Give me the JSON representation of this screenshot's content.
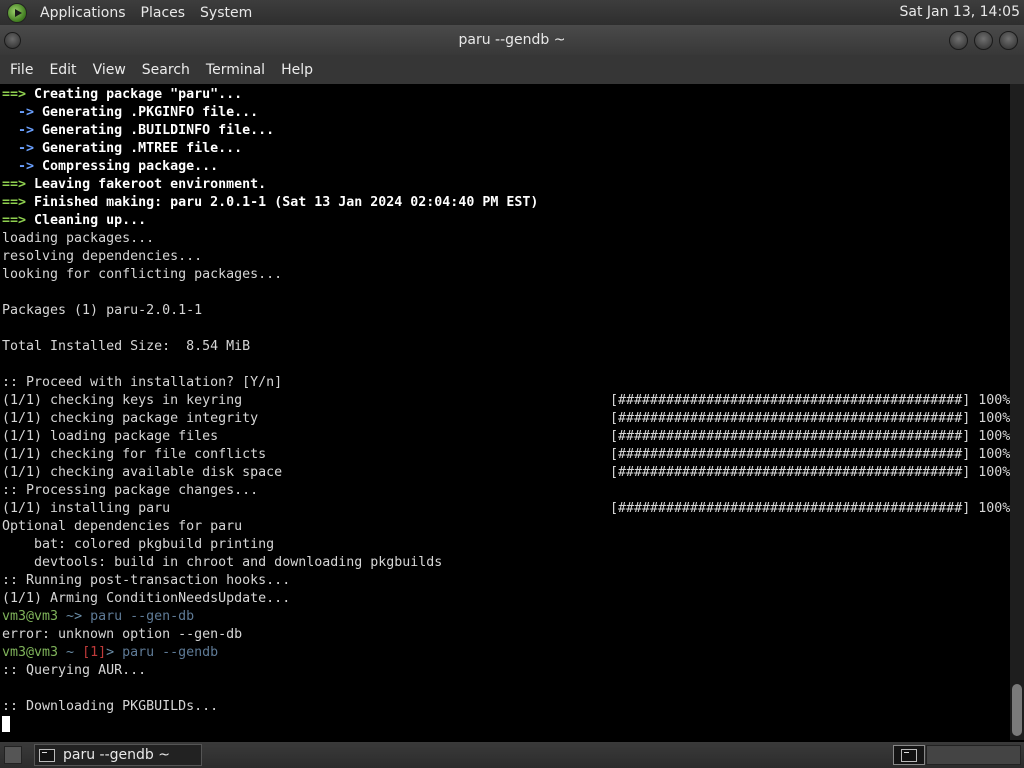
{
  "top_panel": {
    "menus": [
      "Applications",
      "Places",
      "System"
    ],
    "clock": "Sat Jan 13, 14:05",
    "logo_icon": "distro-logo-icon"
  },
  "window": {
    "title": "paru --gendb ~"
  },
  "menubar": [
    "File",
    "Edit",
    "View",
    "Search",
    "Terminal",
    "Help"
  ],
  "terminal": {
    "lines": [
      {
        "kind": "arrow-g",
        "prefix": "==> ",
        "text": "Creating package \"paru\"..."
      },
      {
        "kind": "arrow-b",
        "prefix": "  -> ",
        "text": "Generating .PKGINFO file..."
      },
      {
        "kind": "arrow-b",
        "prefix": "  -> ",
        "text": "Generating .BUILDINFO file..."
      },
      {
        "kind": "arrow-b",
        "prefix": "  -> ",
        "text": "Generating .MTREE file..."
      },
      {
        "kind": "arrow-b",
        "prefix": "  -> ",
        "text": "Compressing package..."
      },
      {
        "kind": "arrow-g",
        "prefix": "==> ",
        "text": "Leaving fakeroot environment."
      },
      {
        "kind": "arrow-g",
        "prefix": "==> ",
        "text": "Finished making: paru 2.0.1-1 (Sat 13 Jan 2024 02:04:40 PM EST)"
      },
      {
        "kind": "arrow-g",
        "prefix": "==> ",
        "text": "Cleaning up..."
      },
      {
        "kind": "plain",
        "text": "loading packages..."
      },
      {
        "kind": "plain",
        "text": "resolving dependencies..."
      },
      {
        "kind": "plain",
        "text": "looking for conflicting packages..."
      },
      {
        "kind": "plain",
        "text": ""
      },
      {
        "kind": "plain",
        "text": "Packages (1) paru-2.0.1-1"
      },
      {
        "kind": "plain",
        "text": ""
      },
      {
        "kind": "plain",
        "text": "Total Installed Size:  8.54 MiB"
      },
      {
        "kind": "plain",
        "text": ""
      },
      {
        "kind": "plain",
        "text": ":: Proceed with installation? [Y/n]"
      },
      {
        "kind": "progress",
        "text": "(1/1) checking keys in keyring",
        "bar": "[###########################################] 100%"
      },
      {
        "kind": "progress",
        "text": "(1/1) checking package integrity",
        "bar": "[###########################################] 100%"
      },
      {
        "kind": "progress",
        "text": "(1/1) loading package files",
        "bar": "[###########################################] 100%"
      },
      {
        "kind": "progress",
        "text": "(1/1) checking for file conflicts",
        "bar": "[###########################################] 100%"
      },
      {
        "kind": "progress",
        "text": "(1/1) checking available disk space",
        "bar": "[###########################################] 100%"
      },
      {
        "kind": "plain",
        "text": ":: Processing package changes..."
      },
      {
        "kind": "progress",
        "text": "(1/1) installing paru",
        "bar": "[###########################################] 100%"
      },
      {
        "kind": "plain",
        "text": "Optional dependencies for paru"
      },
      {
        "kind": "plain",
        "text": "    bat: colored pkgbuild printing"
      },
      {
        "kind": "plain",
        "text": "    devtools: build in chroot and downloading pkgbuilds"
      },
      {
        "kind": "plain",
        "text": ":: Running post-transaction hooks..."
      },
      {
        "kind": "plain",
        "text": "(1/1) Arming ConditionNeedsUpdate..."
      },
      {
        "kind": "prompt",
        "user": "vm3@vm3",
        "path": " ~",
        "err": "",
        "sym": "> ",
        "cmd": "paru --gen-db"
      },
      {
        "kind": "plain",
        "text": "error: unknown option --gen-db"
      },
      {
        "kind": "prompt",
        "user": "vm3@vm3",
        "path": " ~ ",
        "err": "[1]",
        "sym": "> ",
        "cmd": "paru --gendb"
      },
      {
        "kind": "plain",
        "text": ":: Querying AUR..."
      },
      {
        "kind": "plain",
        "text": ""
      },
      {
        "kind": "plain",
        "text": ":: Downloading PKGBUILDs..."
      },
      {
        "kind": "cursor",
        "text": ""
      }
    ]
  },
  "taskbar": {
    "task_label": "paru --gendb ~"
  }
}
